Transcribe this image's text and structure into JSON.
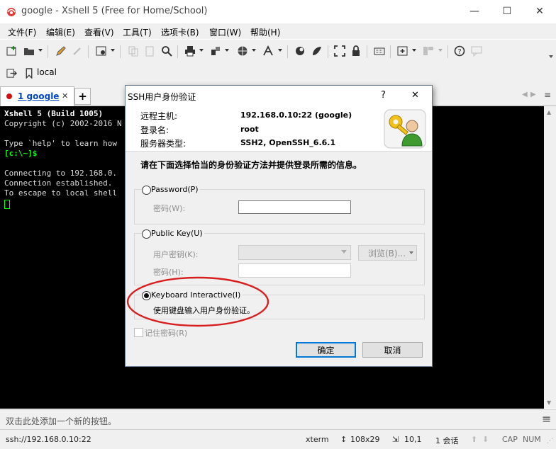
{
  "window": {
    "title": "google - Xshell 5 (Free for Home/School)",
    "min_glyph": "—",
    "max_glyph": "☐",
    "close_glyph": "✕"
  },
  "menu": [
    "文件(F)",
    "编辑(E)",
    "查看(V)",
    "工具(T)",
    "选项卡(B)",
    "窗口(W)",
    "帮助(H)"
  ],
  "linkbar": {
    "label": "local"
  },
  "tabs": {
    "active_label": "1 google",
    "close_glyph": "✕",
    "add_glyph": "+"
  },
  "terminal": {
    "lines": [
      "Xshell 5 (Build 1005)",
      "Copyright (c) 2002-2016 N",
      "",
      "Type `help' to learn how",
      "[c:\\~]$",
      "",
      "Connecting to 192.168.0.",
      "Connection established.",
      "To escape to local shell"
    ]
  },
  "addbar": {
    "text": "双击此处添加一个新的按钮。"
  },
  "status": {
    "connection": "ssh://192.168.0.10:22",
    "term": "xterm",
    "size": "108x29",
    "position": "10,1",
    "sessions": "1 会话",
    "caps": "CAP",
    "num": "NUM"
  },
  "dialog": {
    "title": "SSH用户身份验证",
    "help_glyph": "?",
    "close_glyph": "✕",
    "host_label": "远程主机:",
    "host_value": "192.168.0.10:22 (google)",
    "login_label": "登录名:",
    "login_value": "root",
    "server_label": "服务器类型:",
    "server_value": "SSH2, OpenSSH_6.6.1",
    "instruction": "请在下面选择恰当的身份验证方法并提供登录所需的信息。",
    "password_option": "Password(P)",
    "password_field_label": "密码(W):",
    "publickey_option": "Public Key(U)",
    "user_key_label": "用户密钥(K):",
    "browse_label": "浏览(B)...",
    "passphrase_label": "密码(H):",
    "keyboard_option": "Keyboard Interactive(I)",
    "keyboard_desc": "使用键盘输入用户身份验证。",
    "remember_label": "记住密码(R)",
    "ok_label": "确定",
    "cancel_label": "取消",
    "selected_method": "Keyboard Interactive"
  },
  "colors": {
    "terminal_bg": "#000000",
    "prompt_green": "#00ff00",
    "tab_dot": "#d01010",
    "tab_link": "#0046c8",
    "annotation_red": "#d81e1e",
    "accent_blue": "#0078d7"
  }
}
